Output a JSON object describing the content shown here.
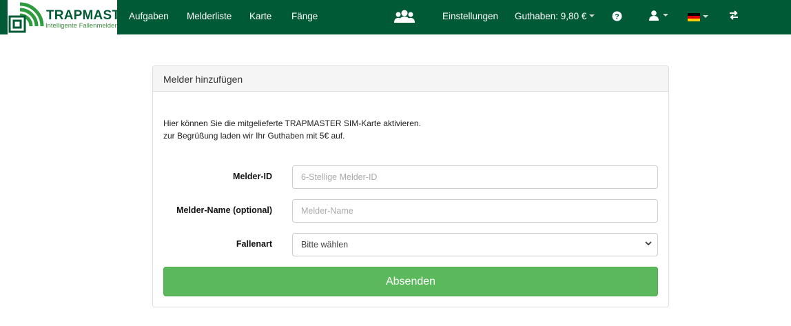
{
  "brand": {
    "title": "TRAPMASTER",
    "subtitle": "Intelligente Fallenmelder",
    "primary_color": "#005a35",
    "accent_color": "#3d8b3d"
  },
  "nav": {
    "items": [
      "Aufgaben",
      "Melderliste",
      "Karte",
      "Fänge"
    ],
    "settings": "Einstellungen",
    "balance": "Guthaben: 9,80 €",
    "icons": [
      "users-icon",
      "help-icon",
      "user-icon",
      "flag-de-icon",
      "switch-icon"
    ]
  },
  "panel": {
    "title": "Melder hinzufügen",
    "intro_line1": "Hier können Sie die mitgelieferte TRAPMASTER SIM-Karte aktivieren.",
    "intro_line2": "zur Begrüßung laden wir Ihr Guthaben mit 5€ auf."
  },
  "form": {
    "melder_id": {
      "label": "Melder-ID",
      "placeholder": "6-Stellige Melder-ID",
      "value": ""
    },
    "melder_name": {
      "label": "Melder-Name (optional)",
      "placeholder": "Melder-Name",
      "value": ""
    },
    "fallenart": {
      "label": "Fallenart",
      "selected": "Bitte wählen"
    },
    "submit_label": "Absenden",
    "submit_color": "#5cb85c"
  }
}
